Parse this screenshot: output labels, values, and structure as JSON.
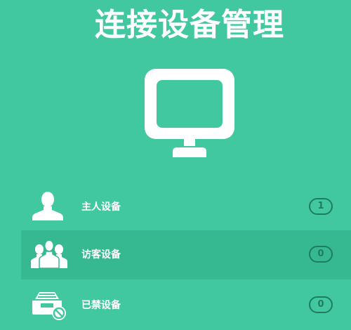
{
  "title": "连接设备管理",
  "colors": {
    "background": "#41c8a1",
    "active_row": "#36b891",
    "badge": "#1f7d5c",
    "icon": "#ffffff"
  },
  "main_icon": "monitor-icon",
  "devices": [
    {
      "label": "主人设备",
      "count": "1",
      "icon": "user-icon"
    },
    {
      "label": "访客设备",
      "count": "0",
      "icon": "users-group-icon"
    },
    {
      "label": "已禁设备",
      "count": "0",
      "icon": "inbox-blocked-icon"
    }
  ]
}
